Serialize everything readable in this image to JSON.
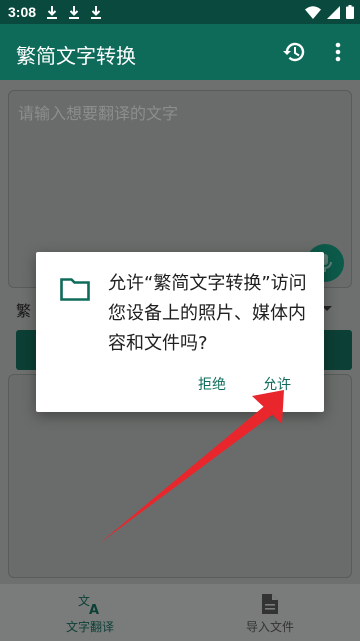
{
  "status_bar": {
    "time": "3:08",
    "download_count": 3
  },
  "app_bar": {
    "title": "繁简文字转换"
  },
  "input": {
    "placeholder": "请输入想要翻译的文字"
  },
  "mode": {
    "label": "繁"
  },
  "dialog": {
    "message": "允许“繁简文字转换”访问您设备上的照片、媒体内容和文件吗?",
    "deny_label": "拒绝",
    "allow_label": "允许"
  },
  "bottom_nav": {
    "items": [
      {
        "label": "文字翻译",
        "icon": "translate-icon",
        "selected": true
      },
      {
        "label": "导入文件",
        "icon": "file-icon",
        "selected": false
      }
    ]
  },
  "colors": {
    "status_bar": "#0a4a3e",
    "app_bar": "#0e6b5a",
    "scrim_content": "#6e706f",
    "accent": "#0e6b5a",
    "arrow": "#e8262c"
  }
}
